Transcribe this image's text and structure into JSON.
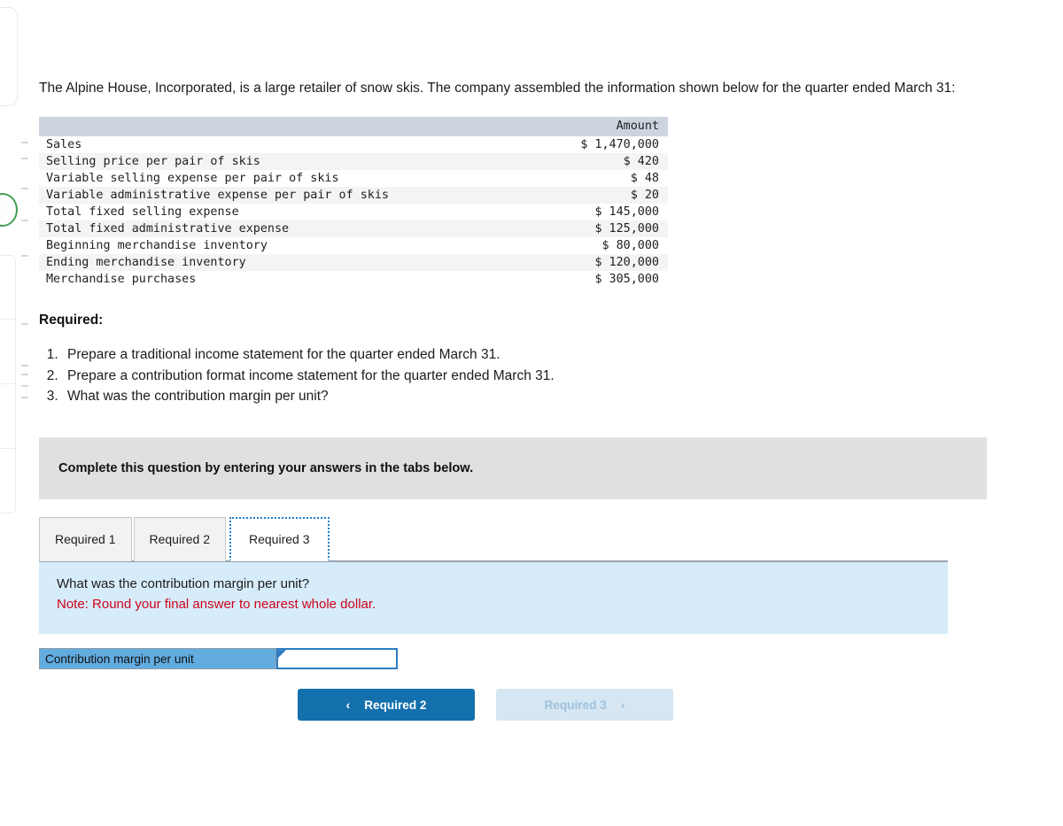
{
  "intro": {
    "paragraph": "The Alpine House, Incorporated, is a large retailer of snow skis. The company assembled the information shown below for the quarter ended March 31:"
  },
  "data_table": {
    "header_label": "",
    "header_amount": "Amount",
    "rows": [
      {
        "label": "Sales",
        "amount": "$ 1,470,000"
      },
      {
        "label": "Selling price per pair of skis",
        "amount": "$ 420"
      },
      {
        "label": "Variable selling expense per pair of skis",
        "amount": "$ 48"
      },
      {
        "label": "Variable administrative expense per pair of skis",
        "amount": "$ 20"
      },
      {
        "label": "Total fixed selling expense",
        "amount": "$ 145,000"
      },
      {
        "label": "Total fixed administrative expense",
        "amount": "$ 125,000"
      },
      {
        "label": "Beginning merchandise inventory",
        "amount": "$ 80,000"
      },
      {
        "label": "Ending merchandise inventory",
        "amount": "$ 120,000"
      },
      {
        "label": "Merchandise purchases",
        "amount": "$ 305,000"
      }
    ]
  },
  "required": {
    "heading": "Required:",
    "items": [
      "Prepare a traditional income statement for the quarter ended March 31.",
      "Prepare a contribution format income statement for the quarter ended March 31.",
      "What was the contribution margin per unit?"
    ]
  },
  "complete_bar": {
    "text": "Complete this question by entering your answers in the tabs below."
  },
  "tabs": {
    "items": [
      {
        "label": "Required 1",
        "active": false
      },
      {
        "label": "Required 2",
        "active": false
      },
      {
        "label": "Required 3",
        "active": true
      }
    ]
  },
  "question_panel": {
    "question": "What was the contribution margin per unit?",
    "note": "Note: Round your final answer to nearest whole dollar."
  },
  "answer": {
    "label": "Contribution margin per unit",
    "value": "",
    "placeholder": ""
  },
  "nav": {
    "prev_label": "Required 2",
    "prev_icon": "chevron-left-icon",
    "prev_chevron": "‹",
    "next_label": "Required 3",
    "next_icon": "chevron-right-icon",
    "next_chevron": "›"
  },
  "colors": {
    "accent_blue": "#1370ad",
    "panel_blue": "#d6ecfa",
    "note_red": "#d0021b",
    "table_header": "#ccd4e0",
    "complete_bar_gray": "#e0e0e0",
    "answer_label_blue": "#63ace0",
    "tab_focus_blue": "#1b7fd4",
    "edge_green": "#3f9e52"
  }
}
